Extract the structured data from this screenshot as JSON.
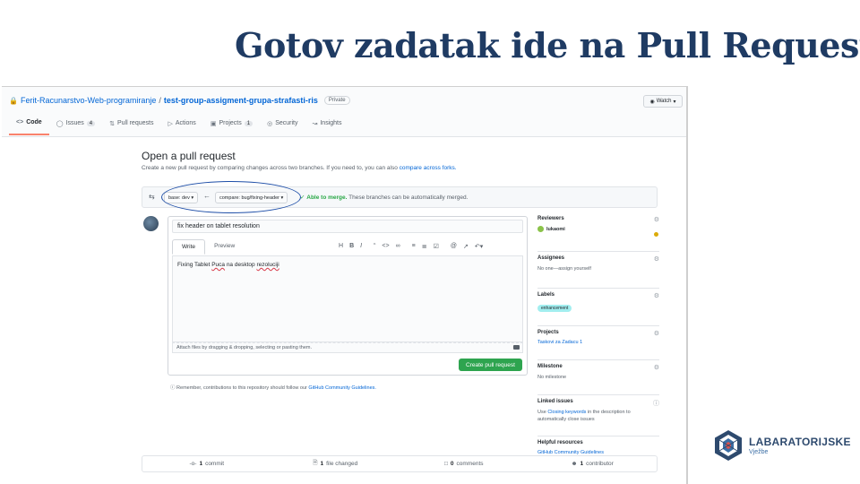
{
  "slide": {
    "title": "Gotov zadatak ide na Pull Request"
  },
  "repo": {
    "owner": "Ferit-Racunarstvo-Web-programiranje",
    "separator": "/",
    "name": "test-group-assigment-grupa-strafasti-ris",
    "visibility": "Private",
    "watch_label": "Watch"
  },
  "tabs": [
    {
      "label": "Code",
      "icon": "code-icon",
      "active": true
    },
    {
      "label": "Issues",
      "icon": "issue-icon",
      "count": "4"
    },
    {
      "label": "Pull requests",
      "icon": "pull-request-icon"
    },
    {
      "label": "Actions",
      "icon": "play-icon"
    },
    {
      "label": "Projects",
      "icon": "project-icon",
      "count": "1"
    },
    {
      "label": "Security",
      "icon": "shield-icon"
    },
    {
      "label": "Insights",
      "icon": "graph-icon"
    }
  ],
  "pr": {
    "heading": "Open a pull request",
    "description": "Create a new pull request by comparing changes across two branches. If you need to, you can also",
    "description_link": "compare across forks.",
    "base_branch": "base: dev",
    "compare_branch": "compare: bug/fixing-header",
    "merge_status": "Able to merge.",
    "merge_note": "These branches can be automatically merged.",
    "title_value": "fix header on tablet resolution",
    "tab_write": "Write",
    "tab_preview": "Preview",
    "body_prefix": "Fixing Tablet ",
    "body_word1": "Puca",
    "body_mid": " na desktop ",
    "body_word2": "rezoluciji",
    "attach_hint": "Attach files by dragging & dropping, selecting or pasting them.",
    "create_label": "Create pull request",
    "remember_text": "Remember, contributions to this repository should follow our",
    "remember_link": "GitHub Community Guidelines."
  },
  "sidebar": {
    "reviewers_label": "Reviewers",
    "reviewer_name": "lukaomi",
    "assignees_label": "Assignees",
    "assignees_text": "No one—assign yourself",
    "labels_label": "Labels",
    "label_value": "enhancement",
    "projects_label": "Projects",
    "project_value": "Taskovi za Zadacu 1",
    "milestone_label": "Milestone",
    "milestone_text": "No milestone",
    "linked_label": "Linked issues",
    "linked_text_pre": "Use",
    "linked_link": "Closing keywords",
    "linked_text_post": "in the description to automatically close issues",
    "helpful_label": "Helpful resources",
    "helpful_link": "GitHub Community Guidelines"
  },
  "stats": {
    "commits_count": "1",
    "commits_label": "commit",
    "files_count": "1",
    "files_label": "file changed",
    "comments_count": "0",
    "comments_label": "comments",
    "contributors_count": "1",
    "contributors_label": "contributor"
  },
  "logo": {
    "name": "LABARATORIJSKE",
    "sub": "Vježbe"
  }
}
